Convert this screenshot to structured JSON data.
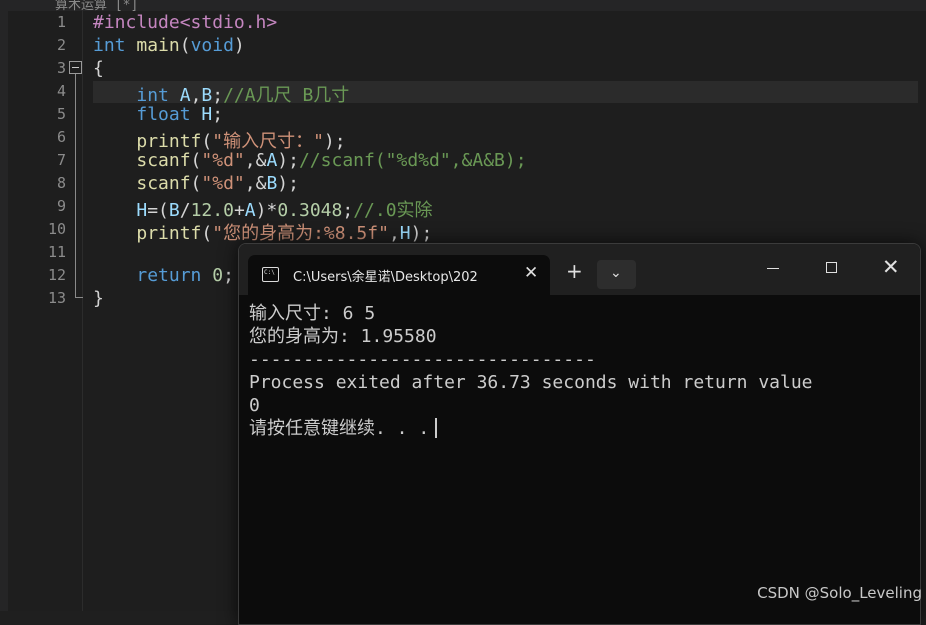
{
  "editor": {
    "tab_text": "算术运算 [*]",
    "lines": [
      {
        "n": "1",
        "code": "#include<stdio.h>"
      },
      {
        "n": "2",
        "code": "int main(void)"
      },
      {
        "n": "3",
        "code": "{"
      },
      {
        "n": "4",
        "code": "    int A,B;//A几尺 B几寸"
      },
      {
        "n": "5",
        "code": "    float H;"
      },
      {
        "n": "6",
        "code": "    printf(\"输入尺寸：\");"
      },
      {
        "n": "7",
        "code": "    scanf(\"%d\",&A);//scanf(\"%d%d\",&A&B);"
      },
      {
        "n": "8",
        "code": "    scanf(\"%d\",&B);"
      },
      {
        "n": "9",
        "code": "    H=(B/12.0+A)*0.3048;//.0实除"
      },
      {
        "n": "10",
        "code": "    printf(\"您的身高为:%8.5f\",H);"
      },
      {
        "n": "11",
        "code": ""
      },
      {
        "n": "12",
        "code": "    return 0;"
      },
      {
        "n": "13",
        "code": "}"
      }
    ],
    "current_line": 4
  },
  "terminal": {
    "tab_title": "C:\\Users\\余星诺\\Desktop\\202",
    "close_label": "✕",
    "new_tab_label": "+",
    "dropdown_label": "⌄",
    "close_window_label": "✕",
    "output": [
      "输入尺寸: 6 5",
      "您的身高为: 1.95580",
      "--------------------------------",
      "Process exited after 36.73 seconds with return value",
      "0",
      "请按任意键继续. . ."
    ]
  },
  "watermark": "CSDN @Solo_Leveling",
  "colors": {
    "keyword": "#569cd6",
    "preprocessor": "#c586c0",
    "string": "#ce9178",
    "comment": "#6a9955",
    "function": "#dcdcaa",
    "terminal_bg": "#0c0c0c"
  },
  "icons": {
    "terminal_tab": "cmd-icon",
    "fold": "fold-minus-icon"
  }
}
